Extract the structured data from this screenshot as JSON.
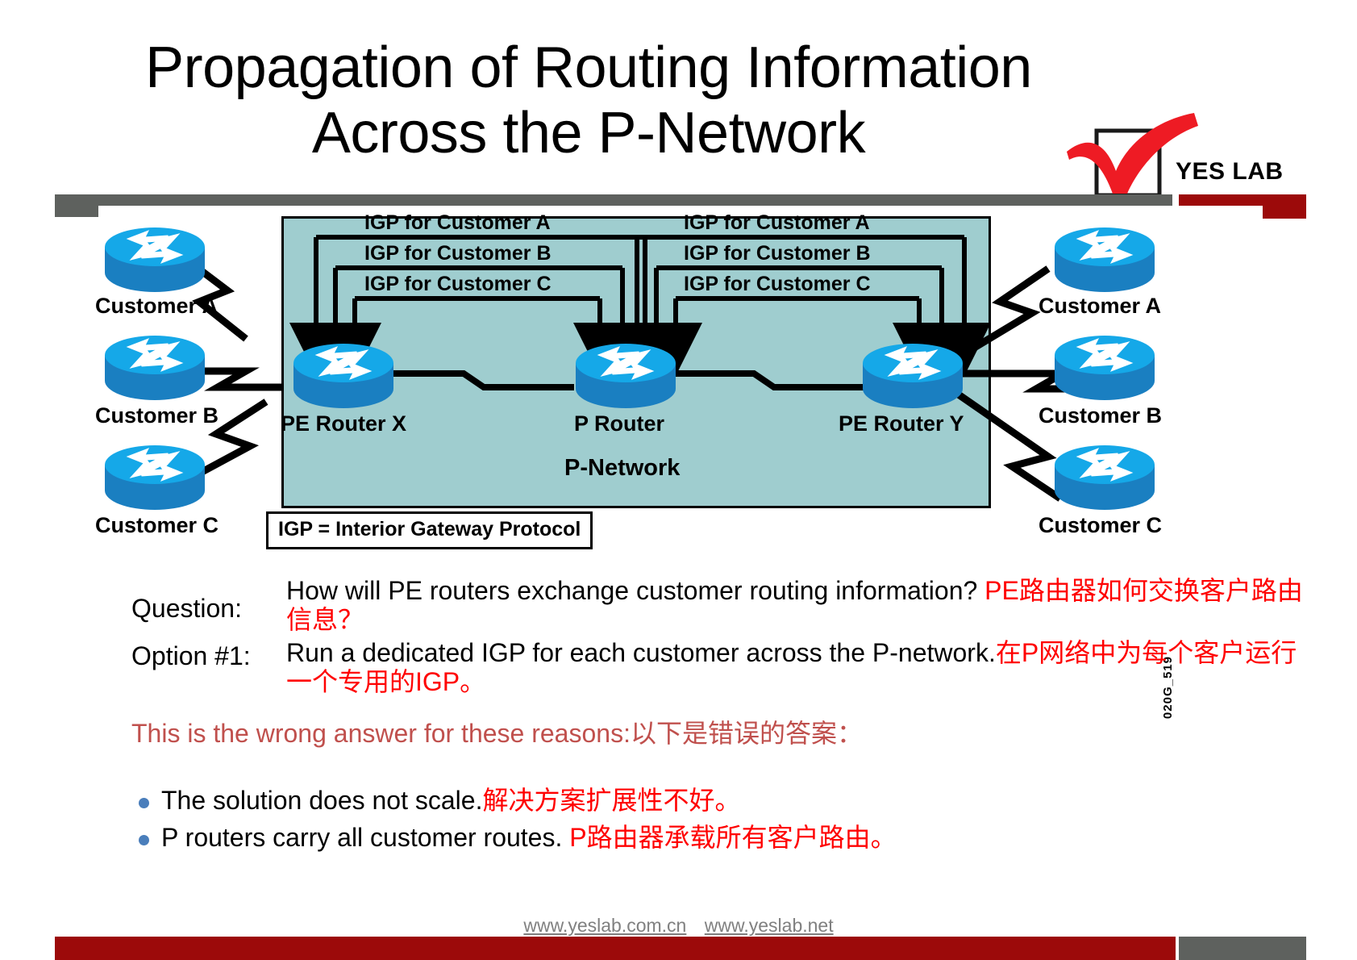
{
  "title": {
    "line1": "Propagation of Routing Information",
    "line2": "Across the P-Network"
  },
  "logo": {
    "text": "YES LAB",
    "accent_color": "#ee1b24"
  },
  "diagram": {
    "pnetwork_label": "P-Network",
    "igp_labels_left": [
      "IGP for Customer A",
      "IGP for Customer B",
      "IGP for Customer C"
    ],
    "igp_labels_right": [
      "IGP for Customer A",
      "IGP for Customer B",
      "IGP for Customer C"
    ],
    "routers": {
      "pe_x": "PE Router X",
      "p": "P Router",
      "pe_y": "PE Router Y"
    },
    "customers_left": [
      "Customer A",
      "Customer B",
      "Customer C"
    ],
    "customers_right": [
      "Customer A",
      "Customer B",
      "Customer C"
    ],
    "legend": "IGP = Interior Gateway Protocol",
    "figure_code": "020G_519",
    "pnetwork_fill": "#9fcdcf"
  },
  "content": {
    "question_label": "Question:",
    "question_en": "How will PE routers exchange customer routing information? ",
    "question_zh": "PE路由器如何交换客户路由信息？",
    "option_label": "Option #1:",
    "option_en": "Run a dedicated IGP for each customer across the P-network.",
    "option_zh": "在P网络中为每个客户运行一个专用的IGP。",
    "wrong_en": "This is the wrong answer for these reasons:",
    "wrong_zh": "以下是错误的答案：",
    "reasons": [
      {
        "en": "The solution does not scale.",
        "zh": "解决方案扩展性不好。"
      },
      {
        "en": "P routers carry all customer routes. ",
        "zh": "P路由器承载所有客户路由。"
      }
    ]
  },
  "footer": {
    "link1": "www.yeslab.com.cn",
    "link2": "www.yeslab.net"
  }
}
